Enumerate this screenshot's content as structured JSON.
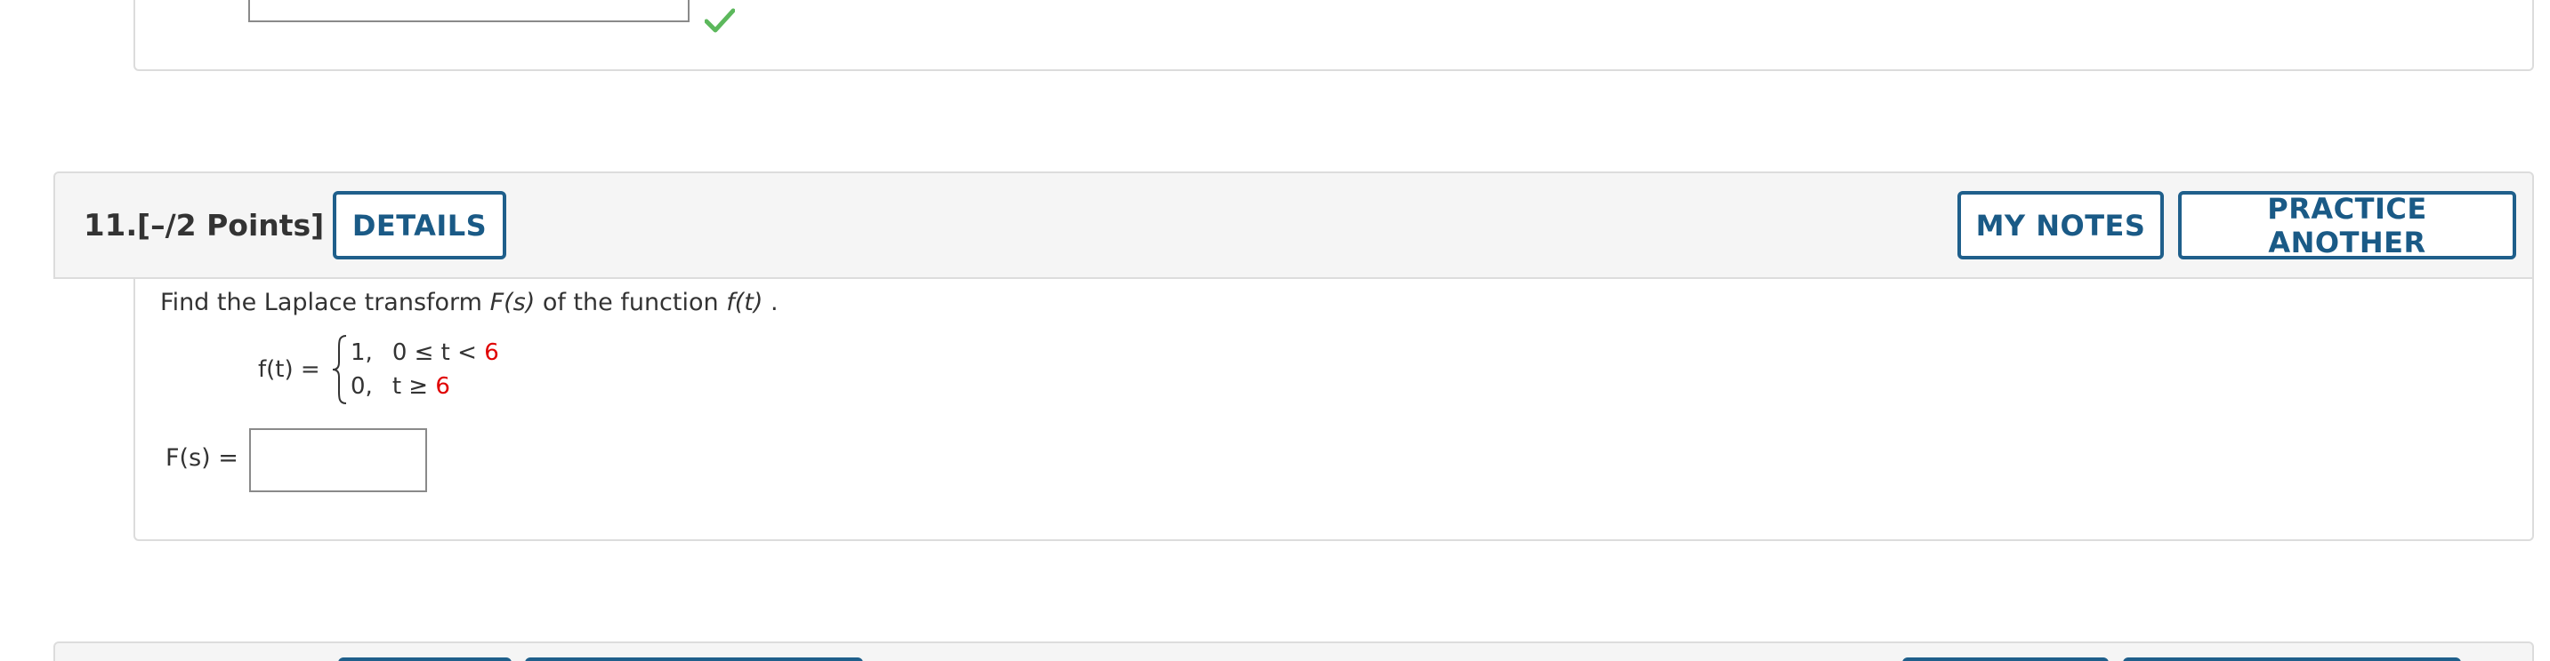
{
  "question": {
    "number": "11.",
    "points": "[–/2 Points]",
    "buttons": {
      "details": "DETAILS",
      "my_notes": "MY NOTES",
      "practice_another": "PRACTICE ANOTHER"
    },
    "prompt": {
      "part1": "Find the Laplace transform ",
      "Fs": "F(s)",
      "part2": " of the function ",
      "ft": "f(t)",
      "part3": "."
    },
    "piecewise": {
      "lhs": "f(t) =",
      "row1_value": "1,",
      "row1_cond": "0 ≤ t < ",
      "row1_bound": "6",
      "row2_value": "0,",
      "row2_cond": "t ≥ ",
      "row2_bound": "6"
    },
    "answer": {
      "label": "F(s) =",
      "value": ""
    }
  },
  "colors": {
    "button_border": "#1f5f8b",
    "button_text": "#1a5a86",
    "highlight": "#e00000",
    "check": "#5cb85c"
  },
  "icons": {
    "correct": "checkmark-icon"
  }
}
